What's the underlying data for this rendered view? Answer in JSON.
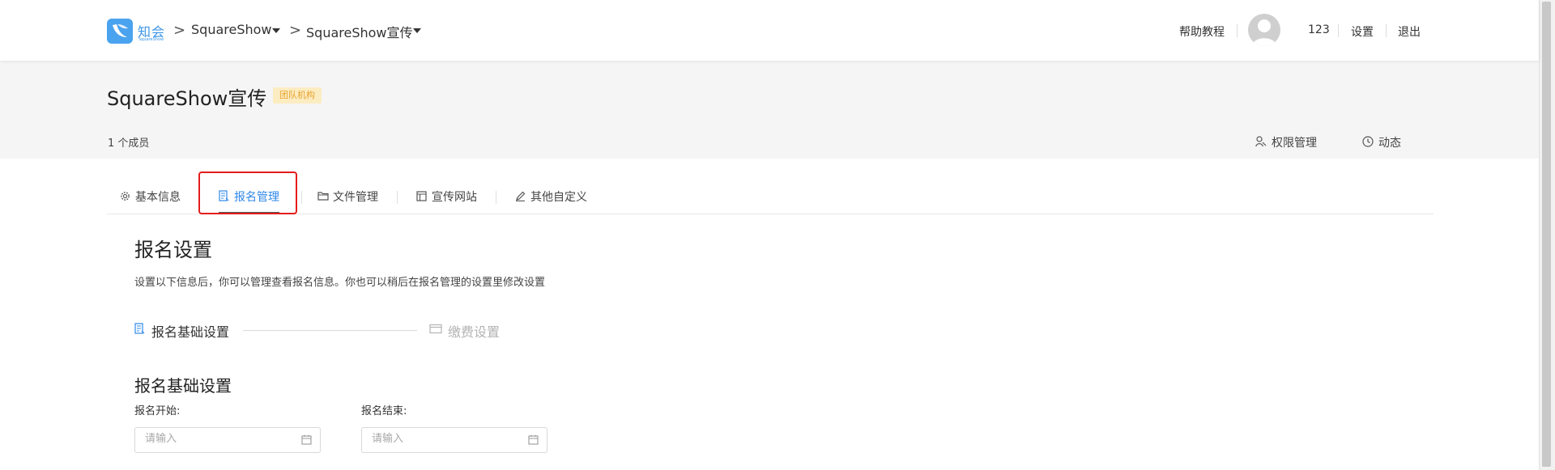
{
  "brand": {
    "name_cn": "知会",
    "name_en": "SquareShow",
    "accent": "#4aa3ef"
  },
  "breadcrumb": {
    "sep": ">",
    "items": [
      {
        "label": "SquareShow"
      },
      {
        "label": "SquareShow宣传"
      }
    ]
  },
  "top_nav": {
    "help": "帮助教程",
    "username": "123",
    "settings": "设置",
    "logout": "退出"
  },
  "header": {
    "title": "SquareShow宣传",
    "badge": "团队机构",
    "members": "1 个成员",
    "permissions": "权限管理",
    "activity": "动态"
  },
  "tabs": [
    {
      "label": "基本信息",
      "icon": "gear-icon",
      "active": false
    },
    {
      "label": "报名管理",
      "icon": "form-icon",
      "active": true
    },
    {
      "label": "文件管理",
      "icon": "folder-icon",
      "active": false
    },
    {
      "label": "宣传网站",
      "icon": "website-icon",
      "active": false
    },
    {
      "label": "其他自定义",
      "icon": "edit-icon",
      "active": false
    }
  ],
  "main": {
    "heading": "报名设置",
    "description": "设置以下信息后，你可以管理查看报名信息。你也可以稍后在报名管理的设置里修改设置",
    "steps": [
      {
        "label": "报名基础设置",
        "active": true
      },
      {
        "label": "缴费设置",
        "active": false
      }
    ],
    "section_title": "报名基础设置",
    "fields": [
      {
        "label": "报名开始:",
        "placeholder": "请输入",
        "value": ""
      },
      {
        "label": "报名结束:",
        "placeholder": "请输入",
        "value": ""
      }
    ]
  },
  "colors": {
    "active_tab": "#2f88e8",
    "badge_bg": "#fcecc2",
    "badge_text": "#e7a32c",
    "highlight": "#e41c1c"
  }
}
